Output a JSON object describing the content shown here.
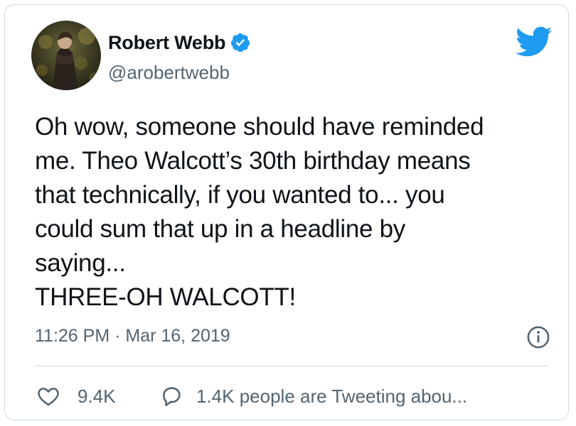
{
  "user": {
    "display_name": "Robert Webb",
    "handle": "@arobertwebb",
    "verified": true,
    "avatar_icon": "profile-photo"
  },
  "tweet": {
    "text": "Oh wow, someone should have reminded\nme. Theo Walcott’s 30th birthday means\nthat technically, if you wanted to... you\ncould sum that up in a headline by\nsaying...\nTHREE-OH WALCOTT!",
    "timestamp": "11:26 PM · Mar 16, 2019"
  },
  "actions": {
    "likes": "9.4K",
    "conversation": "1.4K people are Tweeting abou..."
  },
  "icons": {
    "brand": "twitter-bird-icon",
    "verified": "verified-badge-icon",
    "info": "info-icon",
    "like": "heart-icon",
    "reply": "speech-bubble-icon"
  },
  "colors": {
    "brand_blue": "#1d9bf0",
    "text": "#0f1419",
    "muted": "#536471",
    "border": "#cfd9de"
  }
}
